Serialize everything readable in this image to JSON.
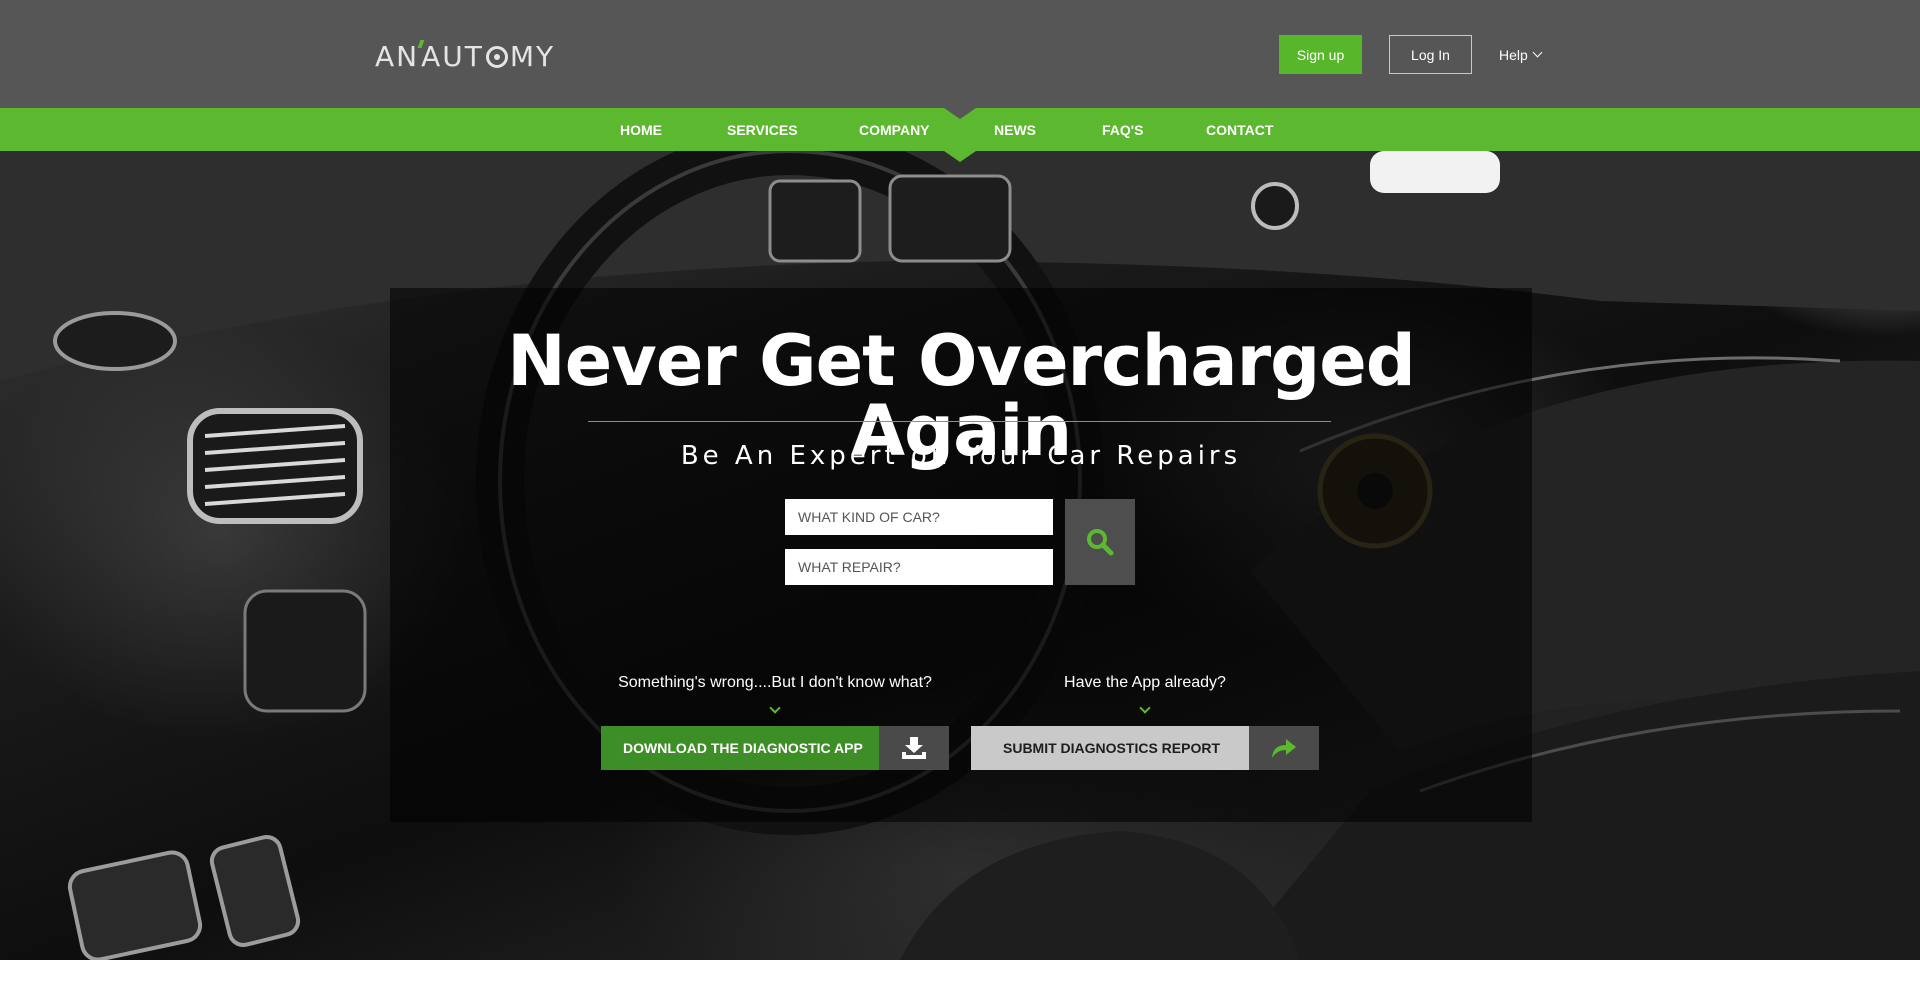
{
  "brand": {
    "logo_text_left": "AN",
    "logo_text_mid": "AUT",
    "logo_text_right": "MY",
    "logo_full": "ANAUTOMY"
  },
  "header": {
    "signup_label": "Sign up",
    "login_label": "Log In",
    "help_label": "Help"
  },
  "nav": {
    "items": [
      {
        "label": "HOME"
      },
      {
        "label": "SERVICES"
      },
      {
        "label": "COMPANY"
      },
      {
        "label": "NEWS"
      },
      {
        "label": "FAQ'S"
      },
      {
        "label": "CONTACT"
      }
    ],
    "active": "COMPANY"
  },
  "hero": {
    "headline": "Never Get Overcharged Again",
    "subheadline": "Be An Expert on Your Car Repairs",
    "search": {
      "car_placeholder": "WHAT KIND OF CAR?",
      "repair_placeholder": "WHAT REPAIR?",
      "icon": "search-icon"
    },
    "left_prompt": "Something's wrong....But I don't know what?",
    "right_prompt": "Have the App already?",
    "download_label": "DOWNLOAD THE DIAGNOSTIC APP",
    "download_icon": "download-icon",
    "submit_label": "SUBMIT DIAGNOSTICS REPORT",
    "submit_icon": "share-arrow-icon"
  },
  "colors": {
    "header_bg": "#565656",
    "accent_green": "#5cb82e",
    "dark_green": "#3e8e27",
    "panel_overlay": "rgba(0,0,0,0.55)"
  }
}
